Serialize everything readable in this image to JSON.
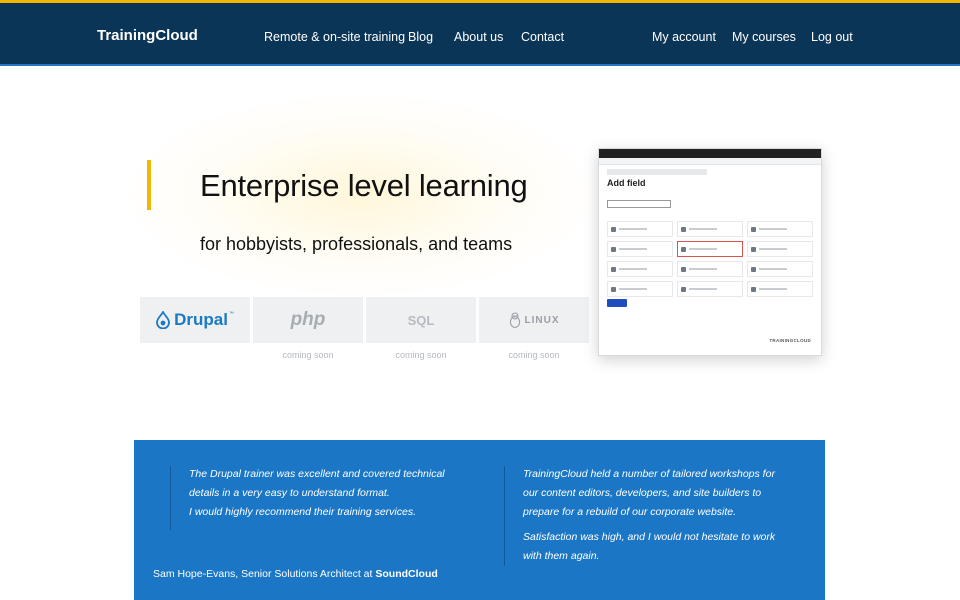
{
  "header": {
    "brand": "TrainingCloud",
    "nav_left": [
      "Remote & on-site training",
      "Blog",
      "About us",
      "Contact"
    ],
    "nav_right": [
      "My account",
      "My courses",
      "Log out"
    ]
  },
  "hero": {
    "title": "Enterprise level learning",
    "subtitle": "for hobbyists, professionals, and teams"
  },
  "technologies": [
    {
      "label": "Drupal",
      "status": ""
    },
    {
      "label": "php",
      "status": "coming soon"
    },
    {
      "label": "SQL",
      "status": "coming soon"
    },
    {
      "label": "LINUX",
      "status": "coming soon"
    }
  ],
  "preview": {
    "title": "Add field",
    "footer": "TRAININGCLOUD"
  },
  "testimonials": {
    "left": [
      "The Drupal trainer was excellent and covered technical",
      "details in a very easy to understand format.",
      "I would highly recommend their training services."
    ],
    "attribution": "Sam Hope-Evans, Senior Solutions Architect at",
    "attribution_company": "SoundCloud",
    "right": [
      "TrainingCloud held a number of tailored workshops for",
      "our content editors, developers, and site builders to",
      "prepare for a rebuild of our corporate website.",
      "Satisfaction was high, and I would not hesitate to work",
      "with them again."
    ]
  },
  "colors": {
    "header_bg": "#0b3556",
    "accent": "#f2b705",
    "testimonial_bg": "#1b77c6"
  }
}
